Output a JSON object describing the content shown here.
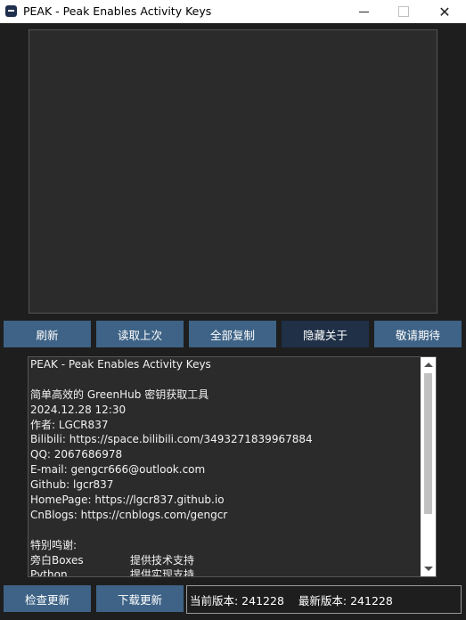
{
  "window": {
    "title": "PEAK - Peak Enables Activity Keys",
    "icon": "peak-app-icon",
    "controls": [
      "minimize",
      "maximize",
      "close"
    ]
  },
  "toolbar": {
    "buttons": [
      {
        "label": "刷新"
      },
      {
        "label": "读取上次"
      },
      {
        "label": "全部复制"
      },
      {
        "label": "隐藏关于"
      },
      {
        "label": "敬请期待"
      }
    ]
  },
  "about": {
    "lines": [
      "PEAK - Peak Enables Activity Keys",
      "",
      "简单高效的 GreenHub 密钥获取工具",
      "2024.12.28 12:30",
      "作者: LGCR837",
      "Bilibili: https://space.bilibili.com/3493271839967884",
      "QQ: 2067686978",
      "E-mail: gengcr666@outlook.com",
      "Github: lgcr837",
      "HomePage: https://lgcr837.github.io",
      "CnBlogs: https://cnblogs.com/gengcr",
      "",
      "特别鸣谢:"
    ],
    "thanks": [
      {
        "name": "旁白Boxes",
        "role": "提供技术支持"
      },
      {
        "name": "Python",
        "role": "提供实现支持"
      }
    ]
  },
  "bottom": {
    "check_update": "检查更新",
    "download_update": "下载更新",
    "current_version_label": "当前版本: 241228",
    "latest_version_label": "最新版本: 241228"
  },
  "colors": {
    "background": "#1e1e1e",
    "button": "#3e6386",
    "button_active": "#1f3047",
    "panel": "#2b2b2b"
  }
}
